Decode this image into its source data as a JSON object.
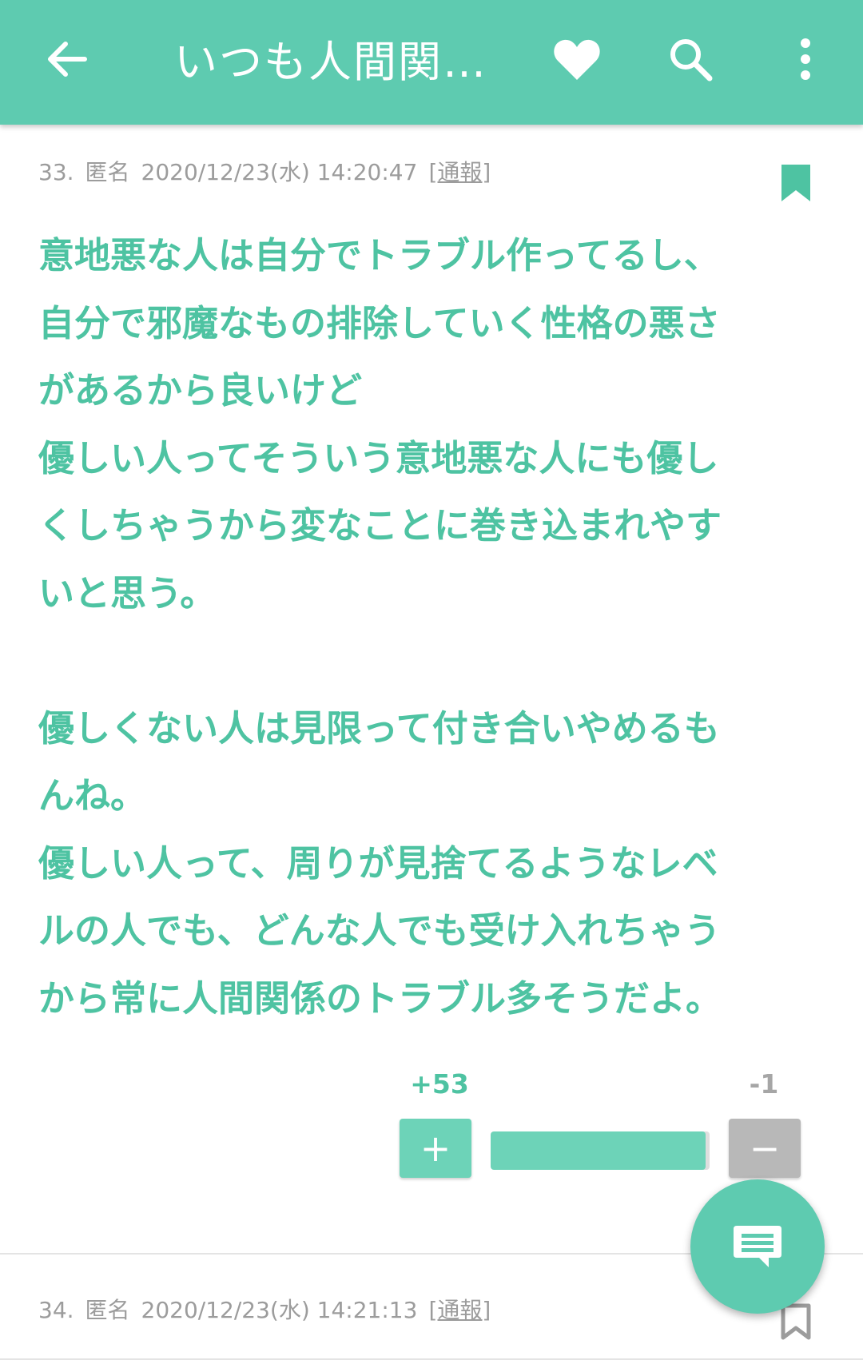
{
  "appbar": {
    "title": "いつも人間関…",
    "back_icon": "arrow-left-icon",
    "favorite_icon": "heart-icon",
    "search_icon": "search-icon",
    "menu_icon": "more-vert-icon",
    "color": "#5ecbb0"
  },
  "posts": [
    {
      "number": "33.",
      "author": "匿名",
      "datetime": "2020/12/23(水) 14:20:47",
      "report_label": "[通報]",
      "bookmarked": true,
      "body_lines": [
        "意地悪な人は自分でトラブル作ってるし、",
        "自分で邪魔なもの排除していく性格の悪さ",
        "があるから良いけど",
        "優しい人ってそういう意地悪な人にも優し",
        "くしちゃうから変なことに巻き込まれやす",
        "いと思う。",
        "",
        "優しくない人は見限って付き合いやめるも",
        "んね。",
        "優しい人って、周りが見捨てるようなレベ",
        "ルの人でも、どんな人でも受け入れちゃう",
        "から常に人間関係のトラブル多そうだよ。"
      ],
      "votes": {
        "plus_count": "+53",
        "minus_count": "-1",
        "plus_label": "+",
        "minus_label": "−",
        "positive_ratio": 0.98
      }
    },
    {
      "number": "34.",
      "author": "匿名",
      "datetime": "2020/12/23(水) 14:21:13",
      "report_label": "[通報]",
      "bookmarked": false
    }
  ],
  "fab": {
    "icon": "comment-icon"
  },
  "colors": {
    "accent": "#5ecbb0",
    "body_text": "#4ec3a2",
    "meta_text": "#9c9c9c",
    "minus": "#b8b8b8"
  }
}
